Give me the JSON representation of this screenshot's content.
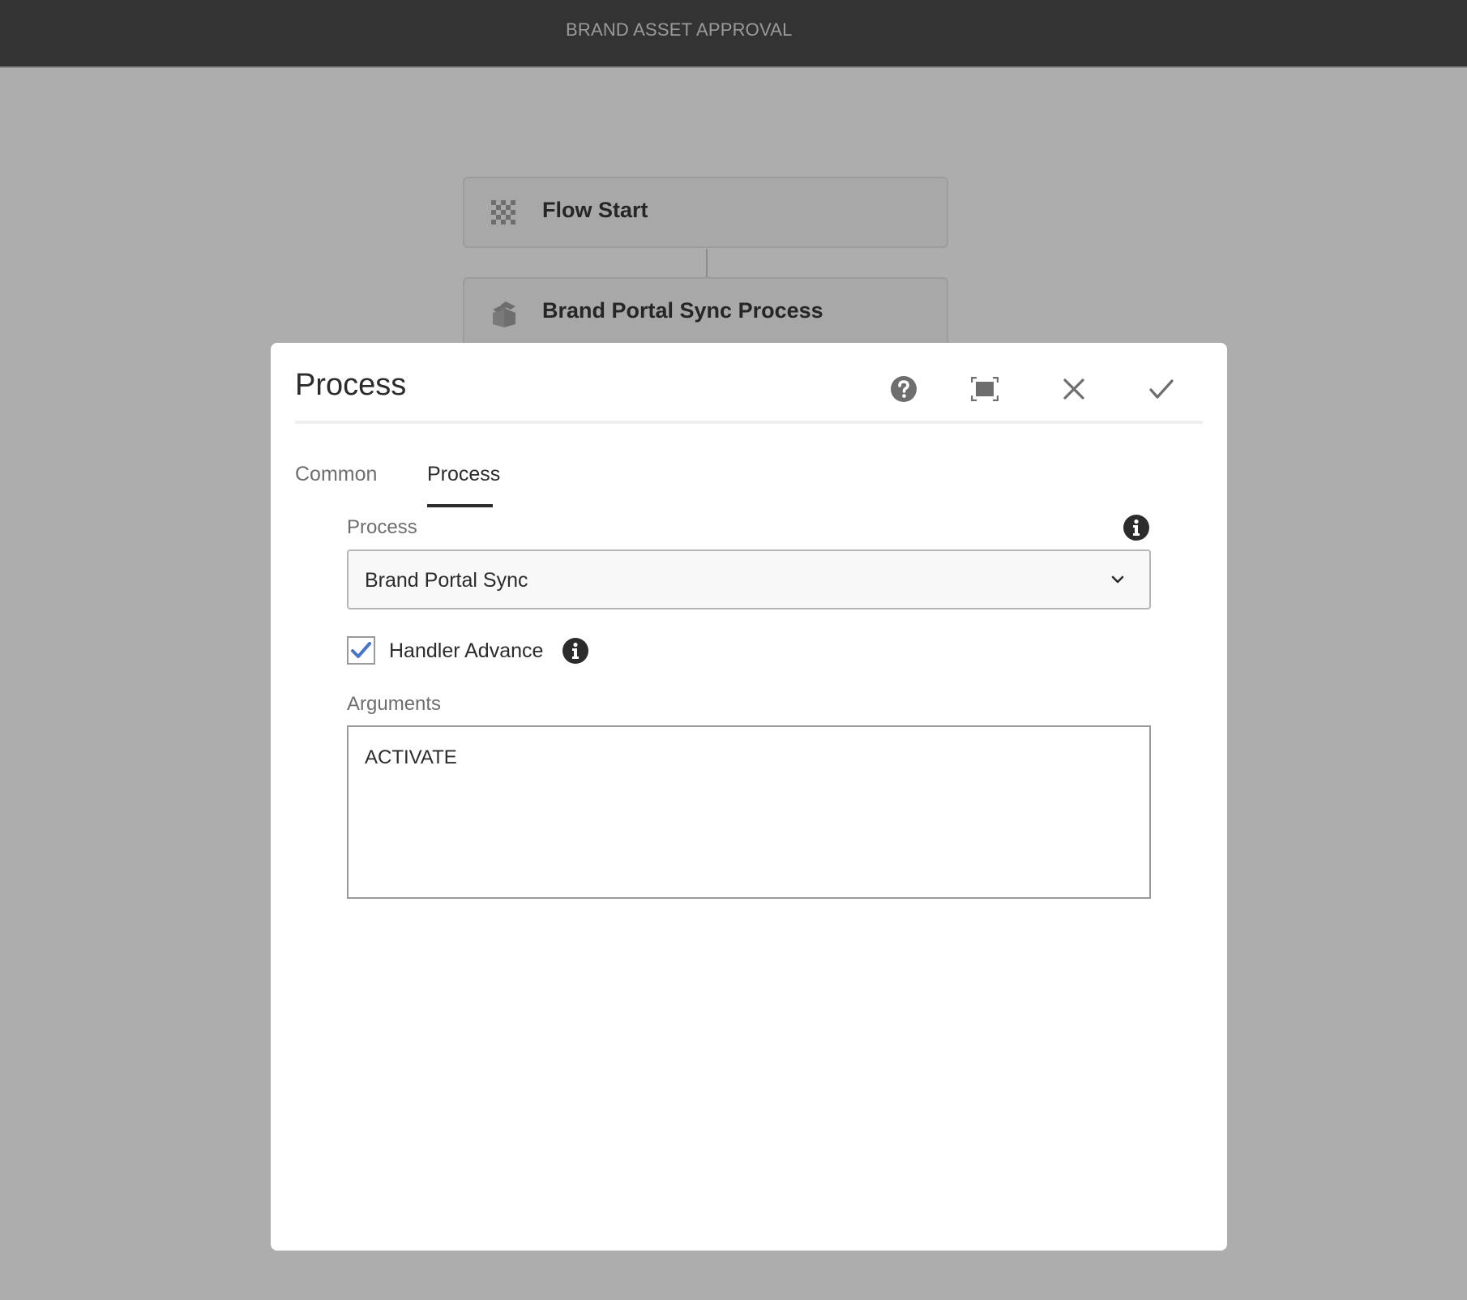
{
  "app": {
    "title": "BRAND ASSET APPROVAL"
  },
  "flow": {
    "nodes": [
      {
        "label": "Flow Start",
        "icon": "checkerboard-icon"
      },
      {
        "label": "Brand Portal Sync Process",
        "icon": "package-icon"
      }
    ]
  },
  "dialog": {
    "title": "Process",
    "header_buttons": [
      {
        "name": "help",
        "icon": "help-icon"
      },
      {
        "name": "fullscreen",
        "icon": "fullscreen-icon"
      },
      {
        "name": "cancel",
        "icon": "close-icon"
      },
      {
        "name": "done",
        "icon": "checkmark-icon"
      }
    ],
    "tabs": [
      {
        "label": "Common",
        "active": false
      },
      {
        "label": "Process",
        "active": true
      }
    ],
    "form": {
      "process_label": "Process",
      "process_value": "Brand Portal Sync",
      "handler_advance_label": "Handler Advance",
      "handler_advance_checked": true,
      "arguments_label": "Arguments",
      "arguments_value": "ACTIVATE"
    }
  },
  "colors": {
    "topbar": "#333333",
    "backdrop": "#adadad",
    "checkbox_check": "#4b75c9",
    "icon_gray": "#6e6e6e",
    "info_icon": "#2c2c2c"
  }
}
